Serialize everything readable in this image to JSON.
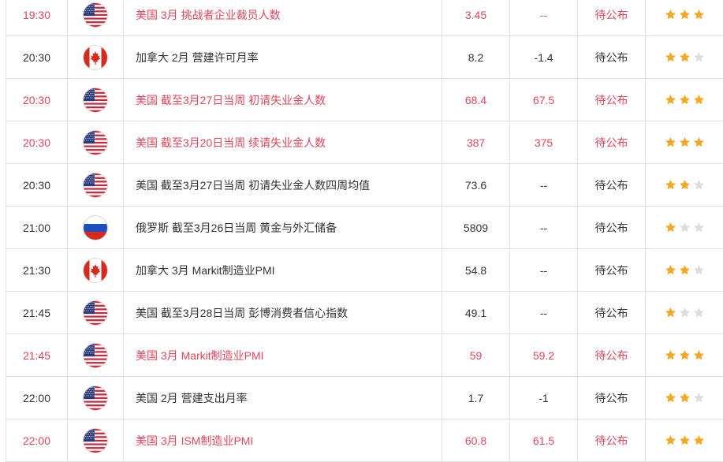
{
  "calendar": {
    "rows": [
      {
        "time": "19:30",
        "country": "us-flag-icon",
        "event": "美国 3月 挑战者企业裁员人数",
        "previous": "3.45",
        "forecast": "--",
        "actual": "待公布",
        "importance": 3,
        "highlight": true
      },
      {
        "time": "20:30",
        "country": "ca-flag-icon",
        "event": "加拿大 2月 营建许可月率",
        "previous": "8.2",
        "forecast": "-1.4",
        "actual": "待公布",
        "importance": 2,
        "highlight": false
      },
      {
        "time": "20:30",
        "country": "us-flag-icon",
        "event": "美国 截至3月27日当周 初请失业金人数",
        "previous": "68.4",
        "forecast": "67.5",
        "actual": "待公布",
        "importance": 3,
        "highlight": true
      },
      {
        "time": "20:30",
        "country": "us-flag-icon",
        "event": "美国 截至3月20日当周 续请失业金人数",
        "previous": "387",
        "forecast": "375",
        "actual": "待公布",
        "importance": 3,
        "highlight": true
      },
      {
        "time": "20:30",
        "country": "us-flag-icon",
        "event": "美国 截至3月27日当周 初请失业金人数四周均值",
        "previous": "73.6",
        "forecast": "--",
        "actual": "待公布",
        "importance": 2,
        "highlight": false
      },
      {
        "time": "21:00",
        "country": "ru-flag-icon",
        "event": "俄罗斯 截至3月26日当周 黄金与外汇储备",
        "previous": "5809",
        "forecast": "--",
        "actual": "待公布",
        "importance": 1,
        "highlight": false
      },
      {
        "time": "21:30",
        "country": "ca-flag-icon",
        "event": "加拿大 3月 Markit制造业PMI",
        "previous": "54.8",
        "forecast": "--",
        "actual": "待公布",
        "importance": 2,
        "highlight": false
      },
      {
        "time": "21:45",
        "country": "us-flag-icon",
        "event": "美国 截至3月28日当周 彭博消费者信心指数",
        "previous": "49.1",
        "forecast": "--",
        "actual": "待公布",
        "importance": 1,
        "highlight": false
      },
      {
        "time": "21:45",
        "country": "us-flag-icon",
        "event": "美国 3月 Markit制造业PMI",
        "previous": "59",
        "forecast": "59.2",
        "actual": "待公布",
        "importance": 3,
        "highlight": true
      },
      {
        "time": "22:00",
        "country": "us-flag-icon",
        "event": "美国 2月 营建支出月率",
        "previous": "1.7",
        "forecast": "-1",
        "actual": "待公布",
        "importance": 2,
        "highlight": false
      },
      {
        "time": "22:00",
        "country": "us-flag-icon",
        "event": "美国 3月 ISM制造业PMI",
        "previous": "60.8",
        "forecast": "61.5",
        "actual": "待公布",
        "importance": 3,
        "highlight": true
      }
    ]
  },
  "colors": {
    "highlight_text": "#e0475b",
    "normal_text": "#333333",
    "grid": "#e2e2e2",
    "star_on": "#f5a623",
    "star_off": "#dddddd"
  }
}
